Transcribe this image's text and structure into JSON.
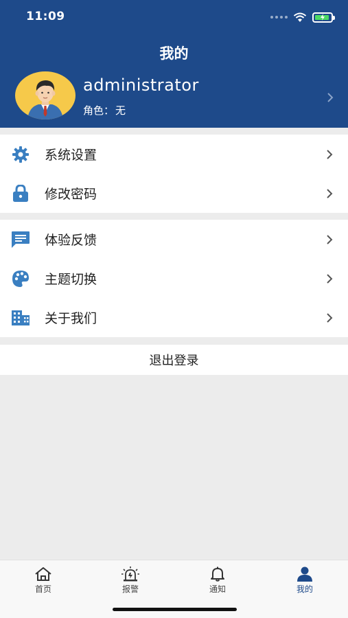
{
  "status_bar": {
    "time": "11:09"
  },
  "header": {
    "title": "我的"
  },
  "profile": {
    "username": "administrator",
    "role_label": "角色：",
    "role_value": "无"
  },
  "menu_group_1": [
    {
      "label": "系统设置",
      "icon": "gear-icon"
    },
    {
      "label": "修改密码",
      "icon": "lock-icon"
    }
  ],
  "menu_group_2": [
    {
      "label": "体验反馈",
      "icon": "message-icon"
    },
    {
      "label": "主题切换",
      "icon": "palette-icon"
    },
    {
      "label": "关于我们",
      "icon": "building-icon"
    }
  ],
  "logout_label": "退出登录",
  "tabs": [
    {
      "label": "首页",
      "icon": "home-icon"
    },
    {
      "label": "报警",
      "icon": "alarm-icon"
    },
    {
      "label": "通知",
      "icon": "bell-icon"
    },
    {
      "label": "我的",
      "icon": "person-icon",
      "active": true
    }
  ],
  "colors": {
    "primary": "#1e4a8a",
    "icon_blue": "#3a7fc1",
    "background": "#ececec"
  }
}
